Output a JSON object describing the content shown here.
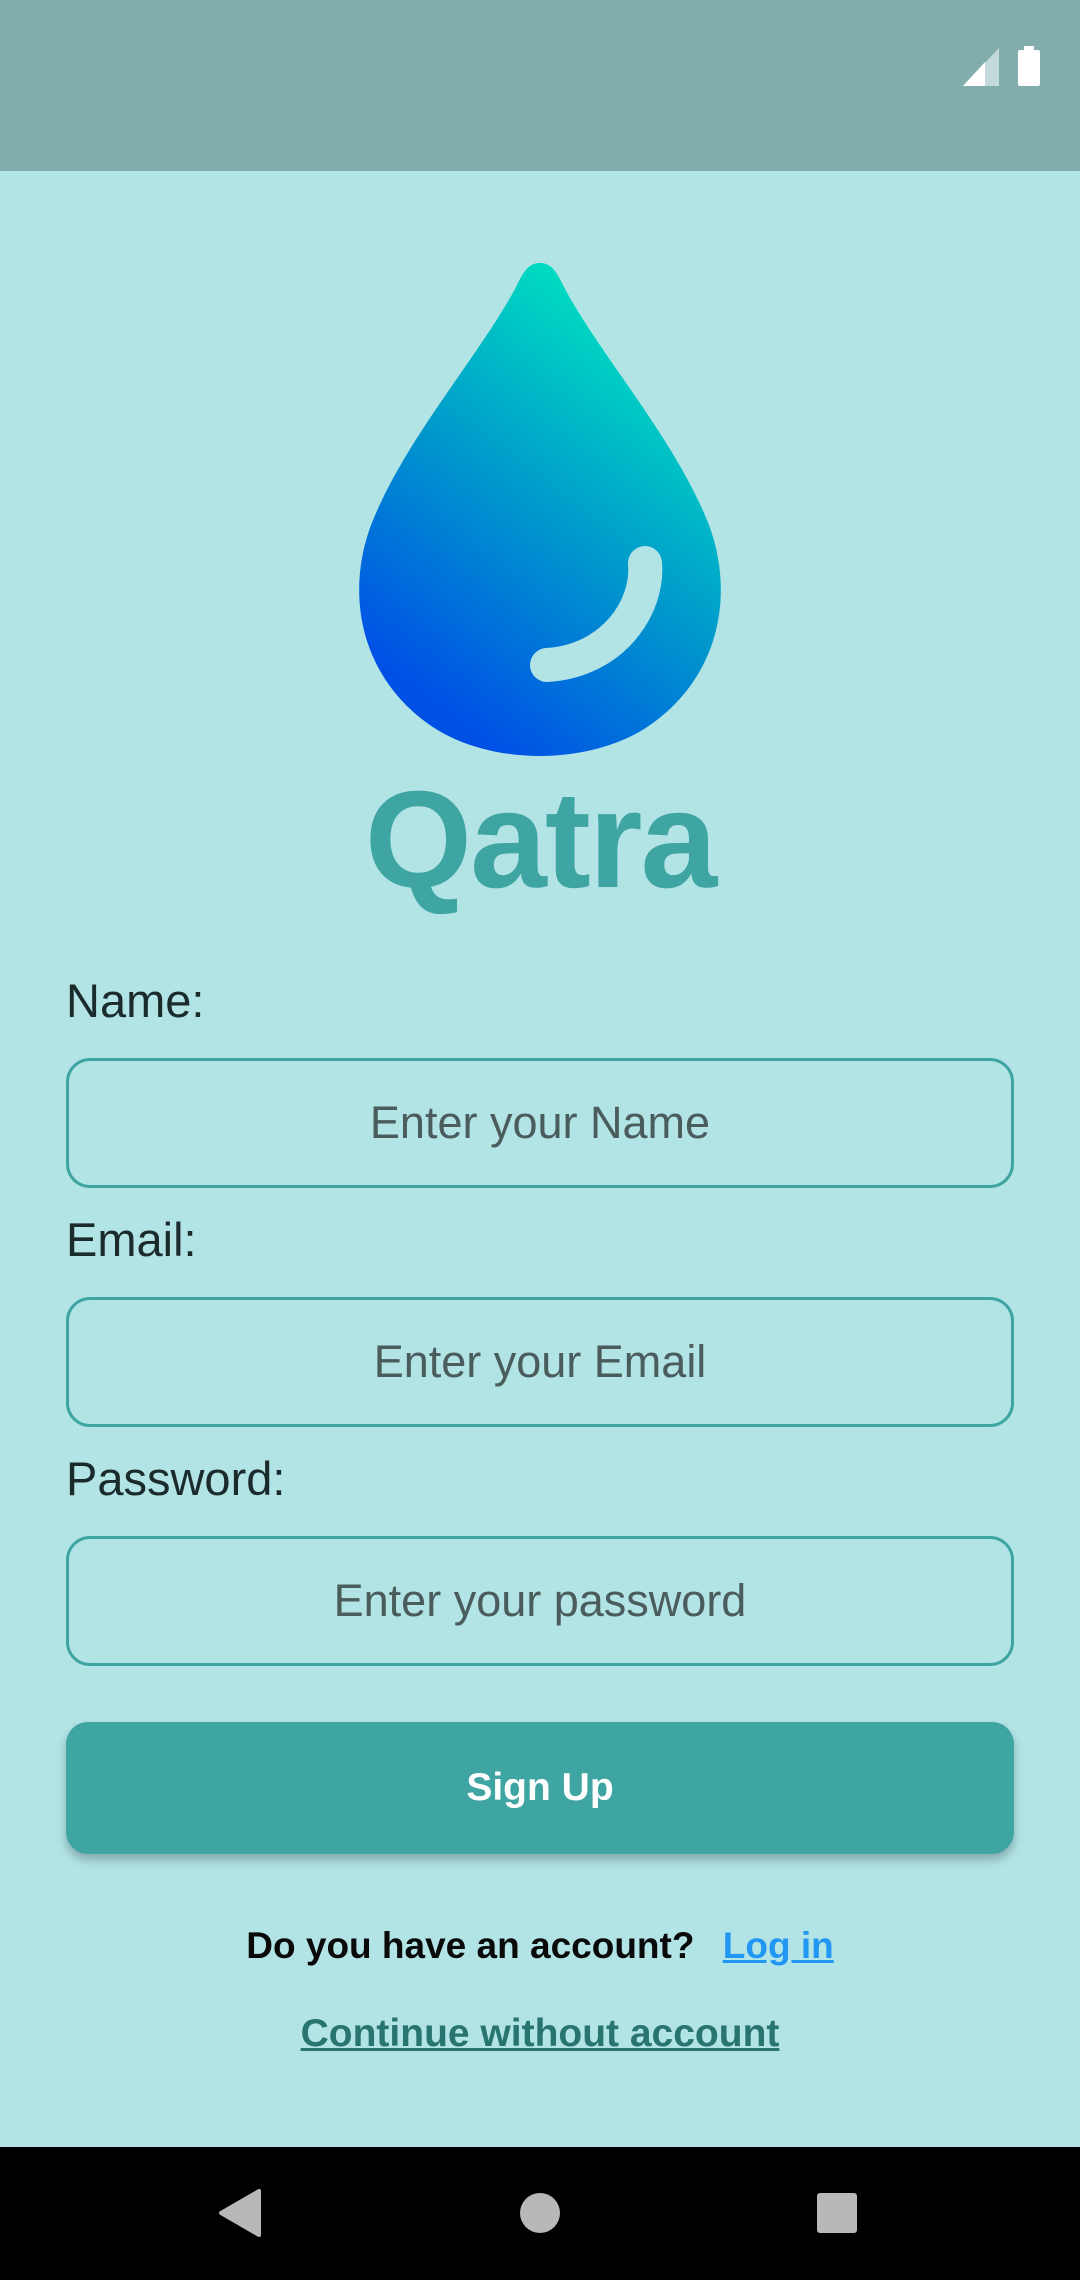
{
  "status_bar": {
    "icons": [
      "signal-icon",
      "battery-icon"
    ],
    "background": "#82adad"
  },
  "brand": {
    "name": "Qatra",
    "icon": "water-drop-logo",
    "color": "#3ea5a2"
  },
  "form": {
    "name_label": "Name:",
    "name_placeholder": "Enter your Name",
    "name_value": "",
    "email_label": "Email:",
    "email_placeholder": "Enter your Email",
    "email_value": "",
    "password_label": "Password:",
    "password_placeholder": "Enter your password",
    "password_value": "",
    "signup_label": "Sign Up"
  },
  "footer": {
    "account_question": "Do you have an account?",
    "login_label": "Log in",
    "continue_label": "Continue without account"
  },
  "nav_bar": {
    "icons": [
      "back-icon",
      "home-icon",
      "recents-icon"
    ]
  },
  "colors": {
    "background": "#b2e4e6",
    "accent": "#3ea5a2",
    "link": "#2196f3",
    "continue_link": "#287470"
  }
}
